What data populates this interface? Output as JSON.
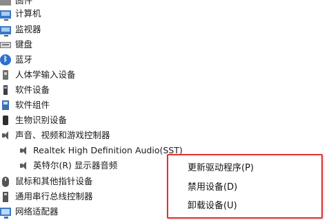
{
  "device_tree": {
    "items": [
      {
        "label": "固件",
        "icon": "firmware-icon"
      },
      {
        "label": "计算机",
        "icon": "computer-icon"
      },
      {
        "label": "监视器",
        "icon": "monitor-icon"
      },
      {
        "label": "键盘",
        "icon": "keyboard-icon"
      },
      {
        "label": "蓝牙",
        "icon": "bluetooth-icon"
      },
      {
        "label": "人体学输入设备",
        "icon": "hid-icon"
      },
      {
        "label": "软件设备",
        "icon": "software-device-icon"
      },
      {
        "label": "软件组件",
        "icon": "software-component-icon"
      },
      {
        "label": "生物识别设备",
        "icon": "biometric-icon"
      },
      {
        "label": "声音、视频和游戏控制器",
        "icon": "speaker-icon"
      },
      {
        "label": "Realtek High Definition Audio(SST)",
        "icon": "speaker-icon"
      },
      {
        "label": "英特尔(R) 显示器音频",
        "icon": "speaker-icon"
      },
      {
        "label": "鼠标和其他指针设备",
        "icon": "mouse-icon"
      },
      {
        "label": "通用串行总线控制器",
        "icon": "usb-icon"
      },
      {
        "label": "网络适配器",
        "icon": "network-icon"
      }
    ]
  },
  "context_menu": {
    "update_driver": "更新驱动程序(P)",
    "disable_device": "禁用设备(D)",
    "uninstall_device": "卸载设备(U)"
  },
  "colors": {
    "highlight_border": "#e03030",
    "icon_blue": "#3a78c3"
  }
}
